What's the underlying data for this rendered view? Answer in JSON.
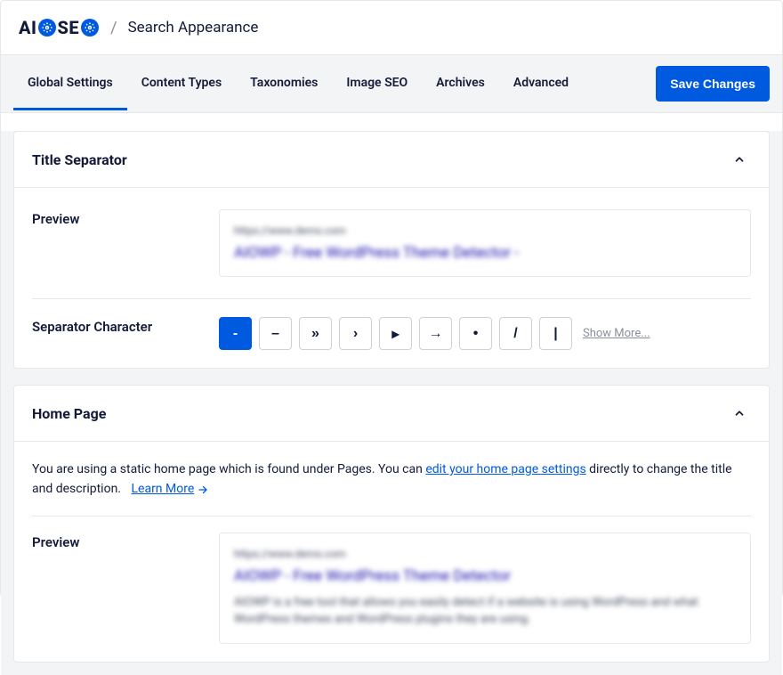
{
  "brand": {
    "part1": "AI",
    "part2": "SE"
  },
  "breadcrumb": {
    "sep": "/",
    "title": "Search Appearance"
  },
  "tabs": [
    {
      "label": "Global Settings",
      "active": true
    },
    {
      "label": "Content Types"
    },
    {
      "label": "Taxonomies"
    },
    {
      "label": "Image SEO"
    },
    {
      "label": "Archives"
    },
    {
      "label": "Advanced"
    }
  ],
  "save_label": "Save Changes",
  "title_separator": {
    "title": "Title Separator",
    "preview_label": "Preview",
    "preview_url": "https://www.demo.com",
    "preview_title": "AIOWP - Free WordPress Theme Detector -",
    "sep_label": "Separator Character",
    "separators": [
      "-",
      "–",
      "»",
      "›",
      "▸",
      "→",
      "•",
      "/",
      "|"
    ],
    "active_index": 0,
    "show_more": "Show More..."
  },
  "home_page": {
    "title": "Home Page",
    "info_pre": "You are using a static home page which is found under Pages. You can ",
    "info_link": "edit your home page settings",
    "info_post": " directly to change the title and description.",
    "learn_more": "Learn More",
    "preview_label": "Preview",
    "preview_url": "https://www.demo.com",
    "preview_title": "AIOWP - Free WordPress Theme Detector",
    "preview_desc": "AIOWP is a free tool that allows you easily detect if a website is using WordPress and what WordPress themes and WordPress plugins they are using."
  }
}
